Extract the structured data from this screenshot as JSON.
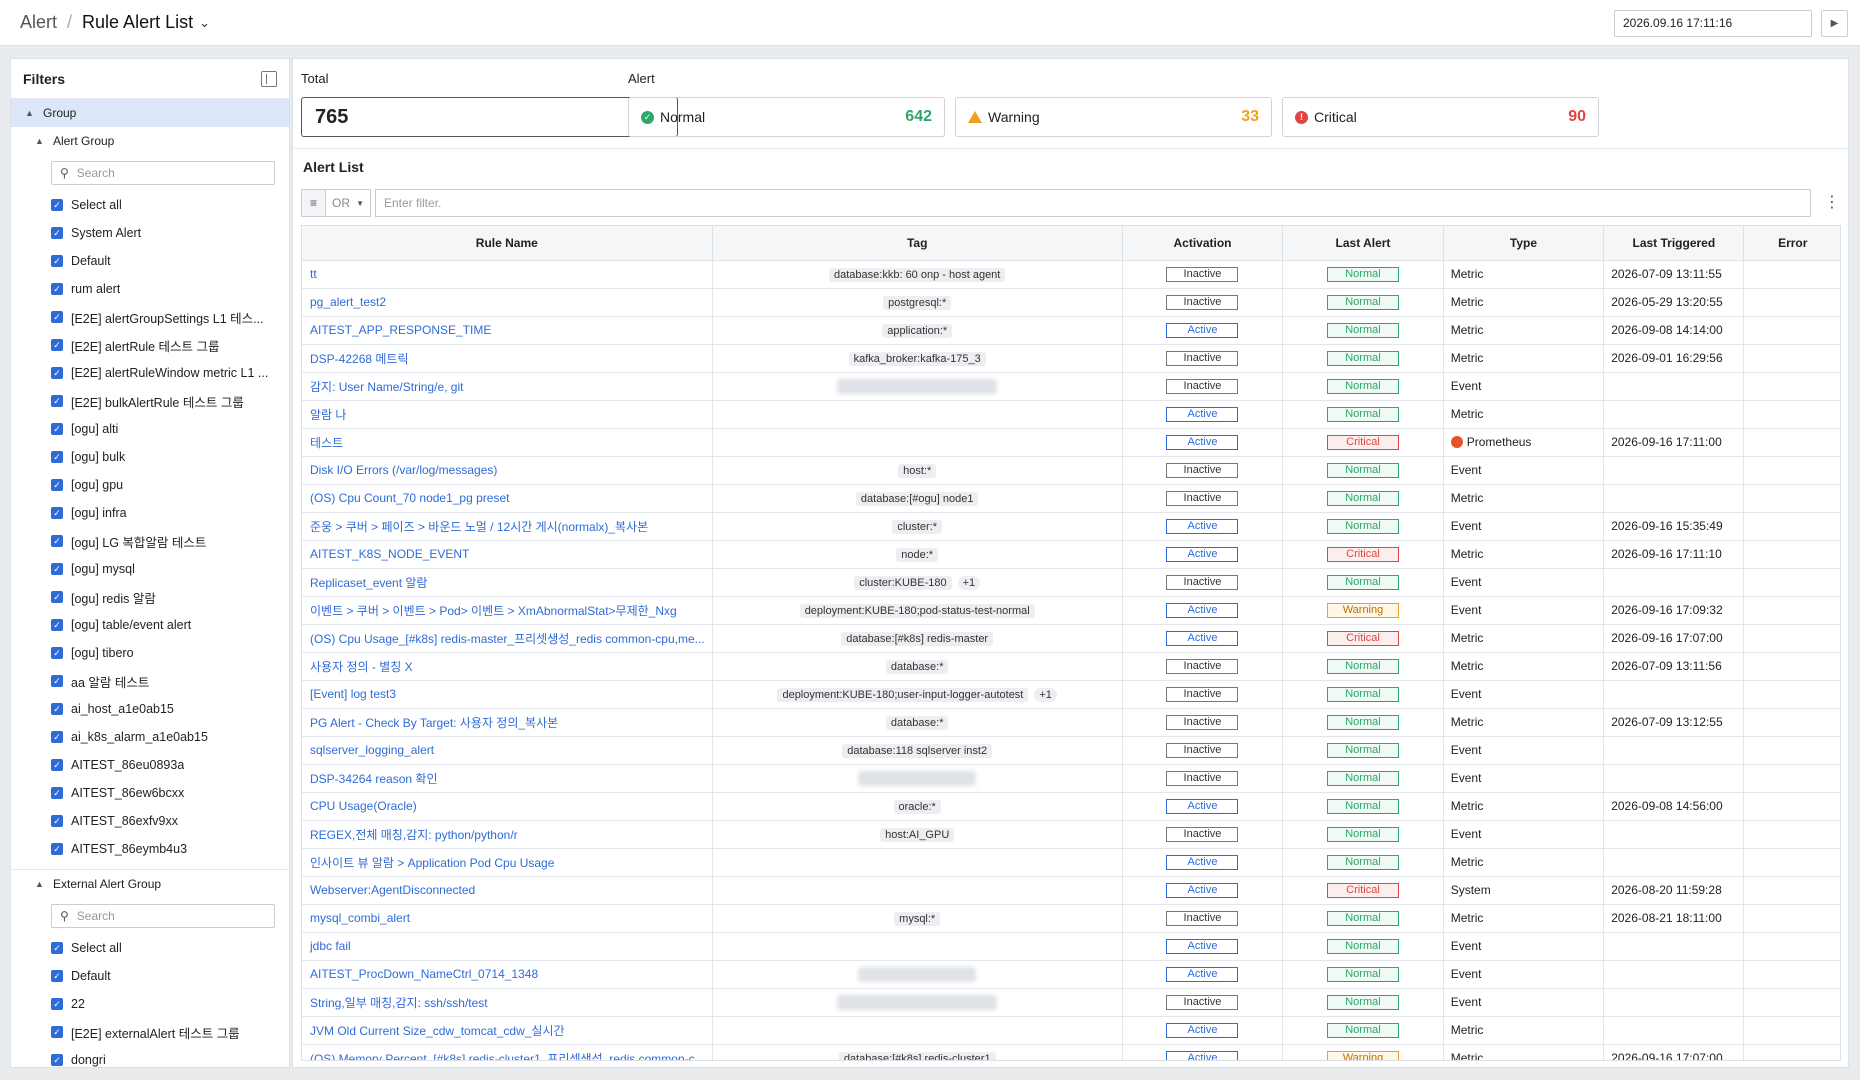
{
  "header": {
    "breadcrumb_root": "Alert",
    "breadcrumb_separator": "/",
    "breadcrumb_current": "Rule Alert List",
    "datetime": "2026.09.16 17:11:16"
  },
  "sidebar": {
    "title": "Filters",
    "group_label": "Group",
    "alert_group": {
      "title": "Alert Group",
      "search_placeholder": "Search",
      "items": [
        "Select all",
        "System Alert",
        "Default",
        "rum alert",
        "[E2E] alertGroupSettings L1 테스...",
        "[E2E] alertRule 테스트 그룹",
        "[E2E] alertRuleWindow metric L1 ...",
        "[E2E] bulkAlertRule 테스트 그룹",
        "[ogu] alti",
        "[ogu] bulk",
        "[ogu] gpu",
        "[ogu] infra",
        "[ogu] LG 복합알람 테스트",
        "[ogu] mysql",
        "[ogu] redis 알람",
        "[ogu] table/event alert",
        "[ogu] tibero",
        "aa 알람 테스트",
        "ai_host_a1e0ab15",
        "ai_k8s_alarm_a1e0ab15",
        "AITEST_86eu0893a",
        "AITEST_86ew6bcxx",
        "AITEST_86exfv9xx",
        "AITEST_86eymb4u3"
      ]
    },
    "external_group": {
      "title": "External Alert Group",
      "search_placeholder": "Search",
      "items": [
        "Select all",
        "Default",
        "22",
        "[E2E] externalAlert 테스트 그룹",
        "dongri"
      ]
    }
  },
  "summary": {
    "total_label": "Total",
    "total": "765",
    "alert_label": "Alert",
    "normal_label": "Normal",
    "normal_count": "642",
    "warning_label": "Warning",
    "warning_count": "33",
    "critical_label": "Critical",
    "critical_count": "90"
  },
  "colors": {
    "normal": "#2aa86a",
    "warning": "#f0a020",
    "critical": "#e04545",
    "accent": "#2f6bd8"
  },
  "alert_list": {
    "title": "Alert List",
    "filter_operator": "OR",
    "filter_placeholder": "Enter filter.",
    "columns": [
      "Rule Name",
      "Tag",
      "Activation",
      "Last Alert",
      "Type",
      "Last Triggered",
      "Error"
    ],
    "rows": [
      {
        "name": "tt",
        "tags": [
          "database:kkb: 60 onp - host agent"
        ],
        "activation": "Inactive",
        "last_alert": "Normal",
        "type": "Metric",
        "triggered": "2026-07-09 13:11:55",
        "error": ""
      },
      {
        "name": "pg_alert_test2",
        "tags": [
          "postgresql:*"
        ],
        "activation": "Inactive",
        "last_alert": "Normal",
        "type": "Metric",
        "triggered": "2026-05-29 13:20:55",
        "error": ""
      },
      {
        "name": "AITEST_APP_RESPONSE_TIME",
        "tags": [
          "application:*"
        ],
        "activation": "Active",
        "last_alert": "Normal",
        "type": "Metric",
        "triggered": "2026-09-08 14:14:00",
        "error": ""
      },
      {
        "name": "DSP-42268 메트릭",
        "tags": [
          "kafka_broker:kafka-175_3"
        ],
        "activation": "Inactive",
        "last_alert": "Normal",
        "type": "Metric",
        "triggered": "2026-09-01 16:29:56",
        "error": ""
      },
      {
        "name": "감지: User Name/String/e, git",
        "tags": [],
        "blurred": "wide",
        "activation": "Inactive",
        "last_alert": "Normal",
        "type": "Event",
        "triggered": "",
        "error": ""
      },
      {
        "name": "알람 나",
        "tags": [],
        "activation": "Active",
        "last_alert": "Normal",
        "type": "Metric",
        "triggered": "",
        "error": ""
      },
      {
        "name": "테스트",
        "tags": [],
        "activation": "Active",
        "last_alert": "Critical",
        "type": "Prometheus",
        "type_icon": "prometheus-icon",
        "triggered": "2026-09-16 17:11:00",
        "error": ""
      },
      {
        "name": "Disk I/O Errors (/var/log/messages)",
        "tags": [
          "host:*"
        ],
        "activation": "Inactive",
        "last_alert": "Normal",
        "type": "Event",
        "triggered": "",
        "error": ""
      },
      {
        "name": "(OS) Cpu Count_70 node1_pg preset",
        "tags": [
          "database:[#ogu] node1"
        ],
        "activation": "Inactive",
        "last_alert": "Normal",
        "type": "Metric",
        "triggered": "",
        "error": ""
      },
      {
        "name": "준웅 > 쿠버 > 페이즈 > 바운드 노멀 / 12시간 게시(normalx)_복사본",
        "tags": [
          "cluster:*"
        ],
        "activation": "Active",
        "last_alert": "Normal",
        "type": "Event",
        "triggered": "2026-09-16 15:35:49",
        "error": ""
      },
      {
        "name": "AITEST_K8S_NODE_EVENT",
        "tags": [
          "node:*"
        ],
        "activation": "Active",
        "last_alert": "Critical",
        "type": "Metric",
        "triggered": "2026-09-16 17:11:10",
        "error": ""
      },
      {
        "name": "Replicaset_event 알람",
        "tags": [
          "cluster:KUBE-180",
          "+1"
        ],
        "activation": "Inactive",
        "last_alert": "Normal",
        "type": "Event",
        "triggered": "",
        "error": ""
      },
      {
        "name": "이벤트 > 쿠버 > 이벤트 > Pod> 이벤트 > XmAbnormalStat>무제한_Nxg",
        "tags": [
          "deployment:KUBE-180;pod-status-test-normal"
        ],
        "activation": "Active",
        "last_alert": "Warning",
        "type": "Event",
        "triggered": "2026-09-16 17:09:32",
        "error": ""
      },
      {
        "name": "(OS) Cpu Usage_[#k8s] redis-master_프리셋생성_redis common-cpu,me...",
        "tags": [
          "database:[#k8s] redis-master"
        ],
        "activation": "Active",
        "last_alert": "Critical",
        "type": "Metric",
        "triggered": "2026-09-16 17:07:00",
        "error": ""
      },
      {
        "name": "사용자 정의 - 별칭 X",
        "tags": [
          "database:*"
        ],
        "activation": "Inactive",
        "last_alert": "Normal",
        "type": "Metric",
        "triggered": "2026-07-09 13:11:56",
        "error": ""
      },
      {
        "name": "[Event] log test3",
        "tags": [
          "deployment:KUBE-180;user-input-logger-autotest",
          "+1"
        ],
        "activation": "Inactive",
        "last_alert": "Normal",
        "type": "Event",
        "triggered": "",
        "error": ""
      },
      {
        "name": "PG Alert - Check By Target: 사용자 정의_복사본",
        "tags": [
          "database:*"
        ],
        "activation": "Inactive",
        "last_alert": "Normal",
        "type": "Metric",
        "triggered": "2026-07-09 13:12:55",
        "error": ""
      },
      {
        "name": "sqlserver_logging_alert",
        "tags": [
          "database:118 sqlserver inst2"
        ],
        "activation": "Inactive",
        "last_alert": "Normal",
        "type": "Event",
        "triggered": "",
        "error": ""
      },
      {
        "name": "DSP-34264 reason 확인",
        "tags": [],
        "blurred": "narrow",
        "activation": "Inactive",
        "last_alert": "Normal",
        "type": "Event",
        "triggered": "",
        "error": ""
      },
      {
        "name": "CPU Usage(Oracle)",
        "tags": [
          "oracle:*"
        ],
        "activation": "Active",
        "last_alert": "Normal",
        "type": "Metric",
        "triggered": "2026-09-08 14:56:00",
        "error": ""
      },
      {
        "name": "REGEX,전체 매칭,감지: python/python/r",
        "tags": [
          "host:AI_GPU"
        ],
        "activation": "Inactive",
        "last_alert": "Normal",
        "type": "Event",
        "triggered": "",
        "error": ""
      },
      {
        "name": "인사이트 뷰 알람 > Application Pod Cpu Usage",
        "tags": [],
        "activation": "Active",
        "last_alert": "Normal",
        "type": "Metric",
        "triggered": "",
        "error": ""
      },
      {
        "name": "Webserver:AgentDisconnected",
        "tags": [],
        "activation": "Active",
        "last_alert": "Critical",
        "type": "System",
        "triggered": "2026-08-20 11:59:28",
        "error": ""
      },
      {
        "name": "mysql_combi_alert",
        "tags": [
          "mysql:*"
        ],
        "activation": "Inactive",
        "last_alert": "Normal",
        "type": "Metric",
        "triggered": "2026-08-21 18:11:00",
        "error": ""
      },
      {
        "name": "jdbc fail",
        "tags": [],
        "activation": "Active",
        "last_alert": "Normal",
        "type": "Event",
        "triggered": "",
        "error": ""
      },
      {
        "name": "AITEST_ProcDown_NameCtrl_0714_1348",
        "tags": [],
        "blurred": "narrow",
        "activation": "Active",
        "last_alert": "Normal",
        "type": "Event",
        "triggered": "",
        "error": ""
      },
      {
        "name": "String,일부 매칭,감지: ssh/ssh/test",
        "tags": [],
        "blurred": "wide",
        "activation": "Inactive",
        "last_alert": "Normal",
        "type": "Event",
        "triggered": "",
        "error": ""
      },
      {
        "name": "JVM Old Current Size_cdw_tomcat_cdw_실시간",
        "tags": [],
        "activation": "Active",
        "last_alert": "Normal",
        "type": "Metric",
        "triggered": "",
        "error": ""
      },
      {
        "name": "(OS) Memory Percent_[#k8s] redis-cluster1_프리셋생성_redis common-c...",
        "tags": [
          "database:[#k8s] redis-cluster1"
        ],
        "activation": "Active",
        "last_alert": "Warning",
        "type": "Metric",
        "triggered": "2026-09-16 17:07:00",
        "error": ""
      }
    ]
  }
}
